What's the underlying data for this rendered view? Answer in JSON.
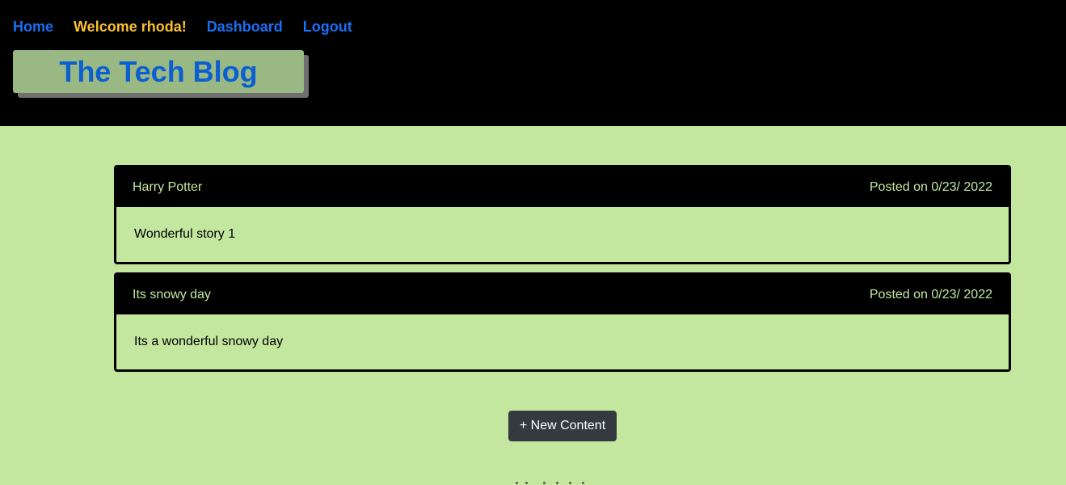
{
  "nav": {
    "home_label": "Home",
    "welcome_label": "Welcome rhoda!",
    "dashboard_label": "Dashboard",
    "logout_label": "Logout"
  },
  "brand": {
    "title": "The Tech Blog"
  },
  "posts": [
    {
      "title": "Harry Potter",
      "date": "Posted on 0/23/ 2022",
      "content": "Wonderful story 1"
    },
    {
      "title": "Its snowy day",
      "date": "Posted on 0/23/ 2022",
      "content": "Its a wonderful snowy day"
    }
  ],
  "actions": {
    "new_content_label": "+ New Content"
  },
  "colors": {
    "page_background": "#c3e79f",
    "header_background": "#000000",
    "nav_link": "#1a6ff5",
    "welcome_text": "#fbc02d",
    "brand_text": "#0a5fd1",
    "brand_background": "#9ab883",
    "button_background": "#343a40"
  }
}
